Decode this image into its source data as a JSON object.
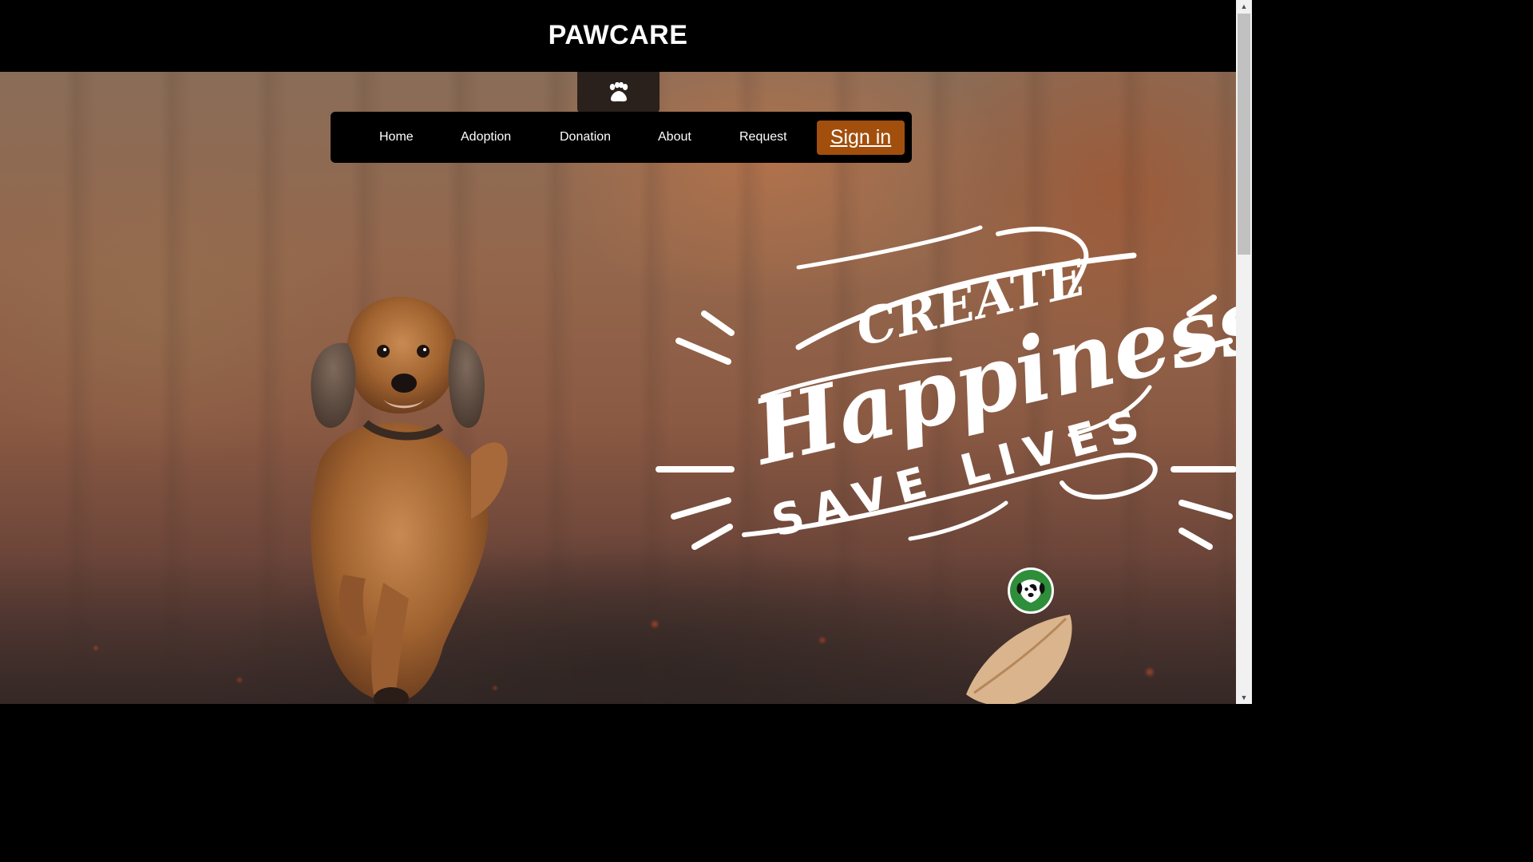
{
  "header": {
    "brand": "PAWCARE"
  },
  "nav": {
    "logo_icon": "paw-icon",
    "items": [
      {
        "label": "Home"
      },
      {
        "label": "Adoption"
      },
      {
        "label": "Donation"
      },
      {
        "label": "About"
      },
      {
        "label": "Request"
      }
    ],
    "signin_label": "Sign in"
  },
  "hero": {
    "slogan_line1": "Create",
    "slogan_line2": "Happiness",
    "slogan_line3": "Save Lives",
    "badge_icon": "dog-face-icon"
  },
  "colors": {
    "header_bg": "#000000",
    "signin_bg": "#a24f0d",
    "paw_tab_bg": "#2a201c",
    "badge_bg": "#2f8e3a"
  }
}
